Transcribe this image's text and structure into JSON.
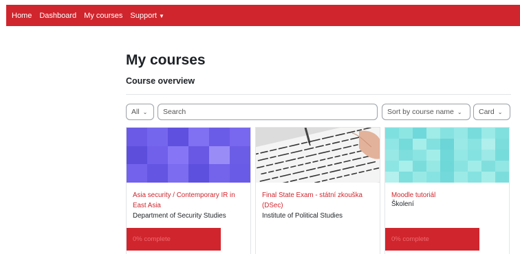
{
  "nav": {
    "items": [
      {
        "label": "Home"
      },
      {
        "label": "Dashboard"
      },
      {
        "label": "My courses"
      },
      {
        "label": "Support"
      }
    ]
  },
  "page": {
    "title": "My courses",
    "section": "Course overview"
  },
  "controls": {
    "filter": "All",
    "search_placeholder": "Search",
    "sort": "Sort by course name",
    "view": "Card"
  },
  "courses": [
    {
      "title": "Asia security / Contemporary IR in East Asia",
      "dept": "Department of Security Studies",
      "progress_label": "0% complete",
      "progress": 0
    },
    {
      "title": "Final State Exam - státní zkouška (DSec)",
      "dept": "Institute of Political Studies"
    },
    {
      "title": "Moodle tutoriál",
      "dept": "Školení",
      "progress_label": "0% complete",
      "progress": 0
    }
  ],
  "colors": {
    "brand": "#d0252d",
    "text": "#1d2125",
    "border": "#9aa0a6"
  }
}
